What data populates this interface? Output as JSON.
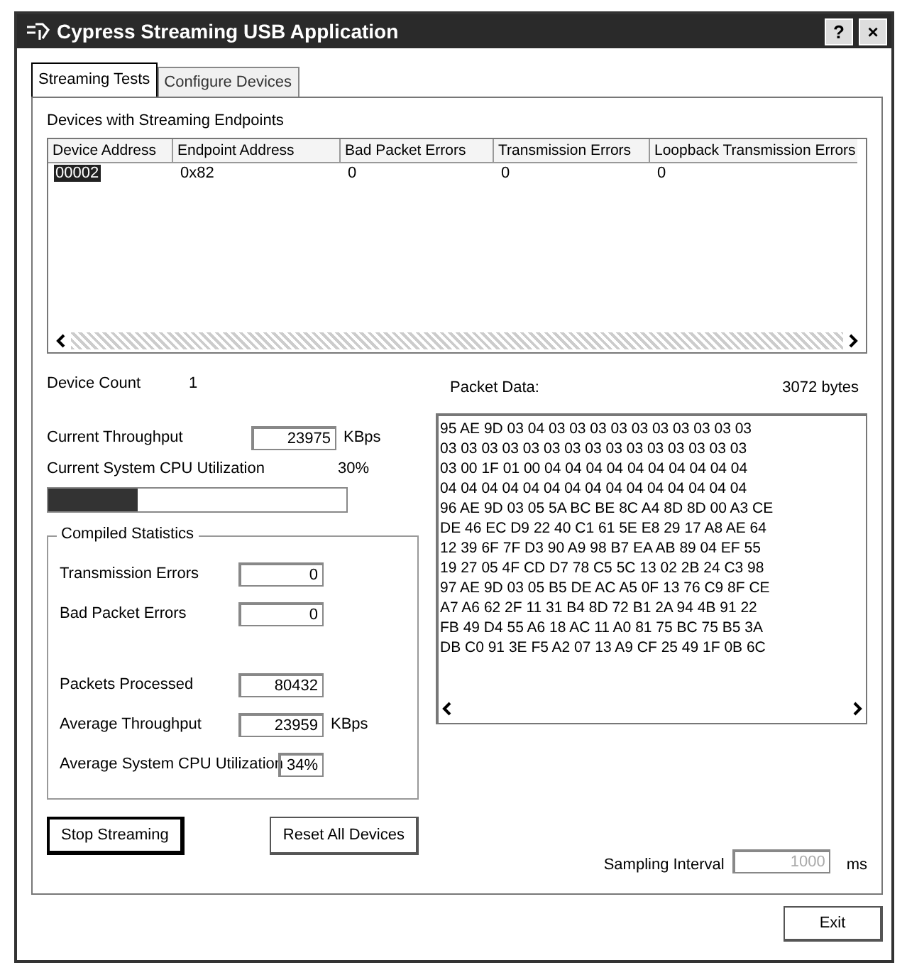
{
  "window": {
    "title": "Cypress Streaming USB Application",
    "help_button": "?",
    "close_button": "×"
  },
  "tabs": [
    {
      "label": "Streaming Tests",
      "selected": true
    },
    {
      "label": "Configure Devices",
      "selected": false
    }
  ],
  "devices": {
    "title": "Devices with Streaming Endpoints",
    "columns": [
      "Device Address",
      "Endpoint Address",
      "Bad Packet Errors",
      "Transmission Errors",
      "Loopback Transmission Errors"
    ],
    "rows": [
      {
        "cells": [
          "00002",
          "0x82",
          "0",
          "0",
          "0"
        ],
        "selected": true
      }
    ]
  },
  "device_count": {
    "label": "Device Count",
    "value": "1"
  },
  "current_throughput": {
    "label": "Current Throughput",
    "value": "23975",
    "unit": "KBps"
  },
  "cpu": {
    "label": "Current System CPU Utilization",
    "reading": "30%",
    "level": 0.3
  },
  "compiled_statistics": {
    "title": "Compiled Statistics",
    "fields": [
      {
        "label": "Transmission Errors",
        "value": "0"
      },
      {
        "label": "Bad Packet Errors",
        "value": "0"
      },
      {
        "label": "Packets Processed",
        "value": "80432"
      },
      {
        "label": "Average Throughput",
        "value": "23959",
        "unit": "KBps"
      },
      {
        "label": "Average System CPU Utilization",
        "value": "34%"
      }
    ]
  },
  "packet_data": {
    "label": "Packet Data:",
    "size": "3072 bytes",
    "lines": [
      "95 AE 9D 03 04 03 03 03 03 03 03 03 03 03 03",
      "03 03 03 03 03 03 03 03 03 03 03 03 03 03 03",
      "03 00 1F 01 00 04 04 04 04 04 04 04 04 04 04",
      "04 04 04 04 04 04 04 04 04 04 04 04 04 04 04",
      "96 AE 9D 03 05 5A BC BE 8C A4 8D 8D 00 A3 CE",
      "DE 46 EC D9 22 40 C1 61 5E E8 29 17 A8 AE 64",
      "12 39 6F 7F D3 90 A9 98 B7 EA AB 89 04 EF 55",
      "19 27 05 4F CD D7 78 C5 5C 13 02 2B 24 C3 98",
      "97 AE 9D 03 05 B5 DE AC A5 0F 13 76 C9 8F CE",
      "A7 A6 62 2F 11 31 B4 8D 72 B1 2A 94 4B 91 22",
      "FB 49 D4 55 A6 18 AC 11 A0 81 75 BC 75 B5 3A",
      "DB C0 91 3E F5 A2 07 13 A9 CF 25 49 1F 0B 6C"
    ]
  },
  "buttons": {
    "stop": "Stop Streaming",
    "reset": "Reset All Devices",
    "exit": "Exit"
  },
  "sampling_interval": {
    "label": "Sampling Interval",
    "value": "1000",
    "unit": "ms",
    "disabled": true
  }
}
